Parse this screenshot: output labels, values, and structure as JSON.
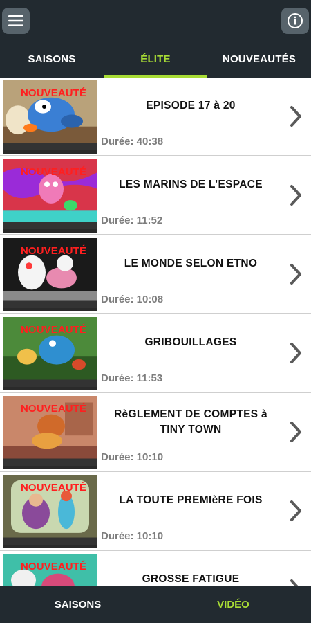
{
  "top_tabs": [
    {
      "label": "SAISONS"
    },
    {
      "label": "ÉLITE"
    },
    {
      "label": "NOUVEAUTÉS"
    }
  ],
  "episodes": [
    {
      "badge": "NOUVEAUTÉ",
      "title": "EPISODE 17 à 20",
      "duration": "Durée: 40:38"
    },
    {
      "badge": "NOUVEAUTÉ",
      "title": "LES MARINS DE L’ESPACE",
      "duration": "Durée: 11:52"
    },
    {
      "badge": "NOUVEAUTÉ",
      "title": "LE MONDE SELON ETNO",
      "duration": "Durée: 10:08"
    },
    {
      "badge": "NOUVEAUTÉ",
      "title": "GRIBOUILLAGES",
      "duration": "Durée: 11:53"
    },
    {
      "badge": "NOUVEAUTÉ",
      "title": "RèGLEMENT DE COMPTES à TINY TOWN",
      "duration": "Durée: 10:10"
    },
    {
      "badge": "NOUVEAUTÉ",
      "title": "LA TOUTE PREMIèRE FOIS",
      "duration": "Durée: 10:10"
    },
    {
      "badge": "NOUVEAUTÉ",
      "title": "GROSSE FATIGUE",
      "duration": ""
    }
  ],
  "bottom_nav": [
    {
      "label": "SAISONS"
    },
    {
      "label": "VIDÉO"
    }
  ],
  "colors": {
    "accent": "#a8dc35",
    "bar": "#222a30",
    "badge": "#ff1f1f"
  },
  "icons": {
    "menu": "hamburger-icon",
    "info": "info-icon",
    "chevron": "chevron-right-icon"
  }
}
